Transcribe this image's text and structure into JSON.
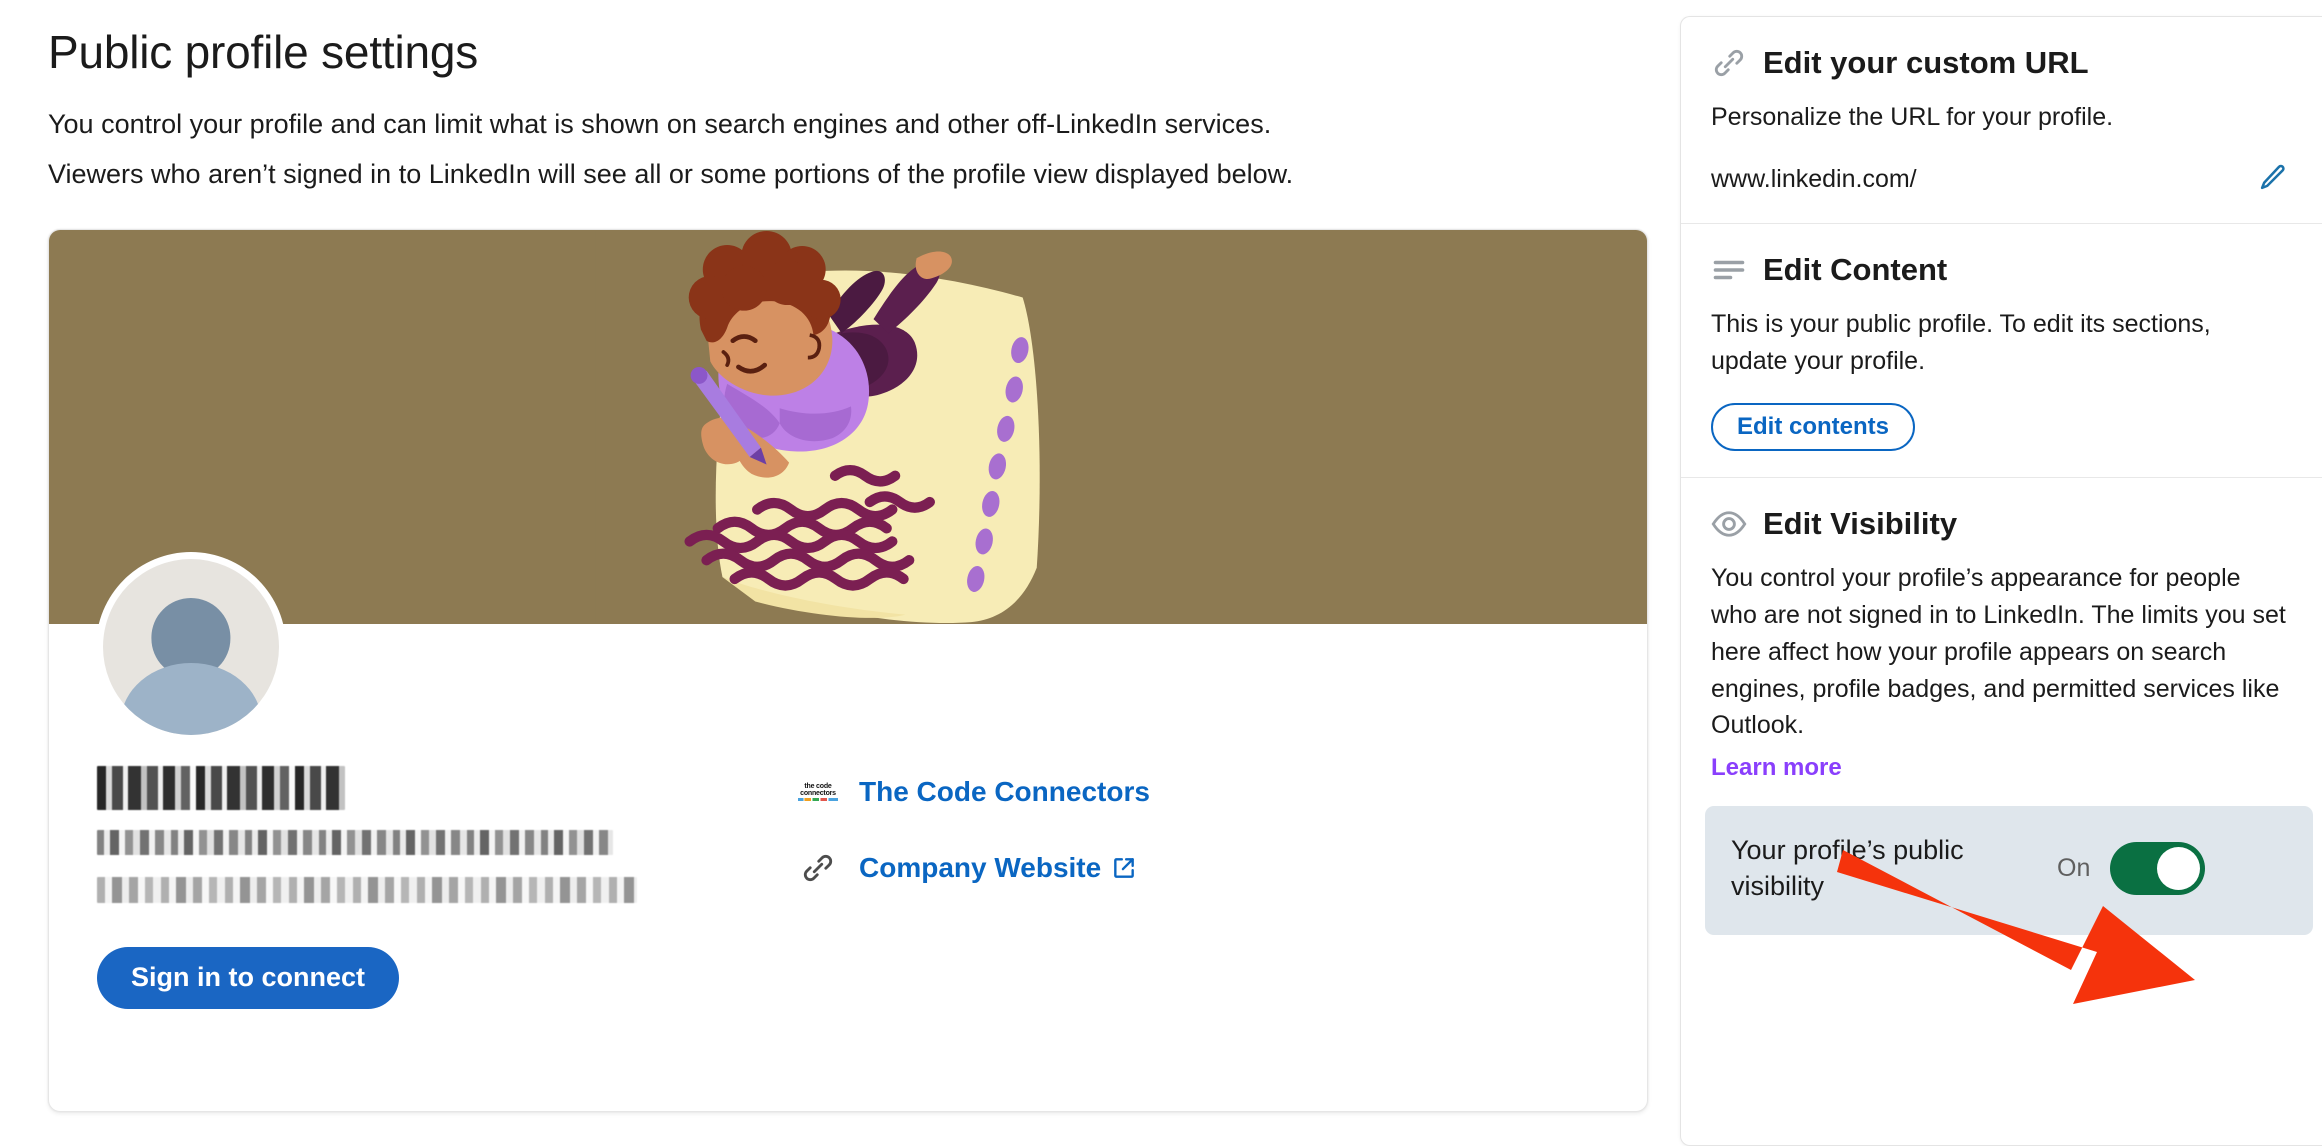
{
  "header": {
    "title": "Public profile settings",
    "desc_line1": "You control your profile and can limit what is shown on search engines and other off-LinkedIn services.",
    "desc_line2": "Viewers who aren’t signed in to LinkedIn will see all or some portions of the profile view displayed below."
  },
  "profile_preview": {
    "banner_color": "#8d7a52",
    "avatar": "default-avatar-icon",
    "name": "[redacted]",
    "headline": "[redacted]",
    "location": "[redacted]",
    "signin_button": "Sign in to connect",
    "links": [
      {
        "icon": "company-logo-icon",
        "logo_line1": "the code",
        "logo_line2": "connectors",
        "label": "The Code Connectors",
        "external": false
      },
      {
        "icon": "link-icon",
        "label": "Company Website",
        "external": true
      }
    ]
  },
  "sidebar": {
    "custom_url": {
      "icon": "link-icon",
      "title": "Edit your custom URL",
      "description": "Personalize the URL for your profile.",
      "url_value": "www.linkedin.com/",
      "edit_icon": "pencil-icon"
    },
    "content": {
      "icon": "list-lines-icon",
      "title": "Edit Content",
      "description": "This is your public profile. To edit its sections, update your profile.",
      "button_label": "Edit contents"
    },
    "visibility": {
      "icon": "eye-icon",
      "title": "Edit Visibility",
      "description": "You control your profile’s appearance for people who are not signed in to LinkedIn. The limits you set here affect how your profile appears on search engines, profile badges, and permitted services like Outlook.",
      "learn_more_label": "Learn more",
      "toggle_label": "Your profile’s public visibility",
      "toggle_state": "On"
    }
  },
  "annotation": {
    "arrow_color": "#f5330c",
    "points_to": "public-visibility-toggle"
  },
  "colors": {
    "linkedin_blue": "#0a66c2",
    "button_blue": "#1a66c3",
    "toggle_green": "#0a7042",
    "learn_more_purple": "#8a3ffc",
    "banner_olive": "#8d7a52",
    "visibility_box_bg": "#dfe6ec"
  }
}
